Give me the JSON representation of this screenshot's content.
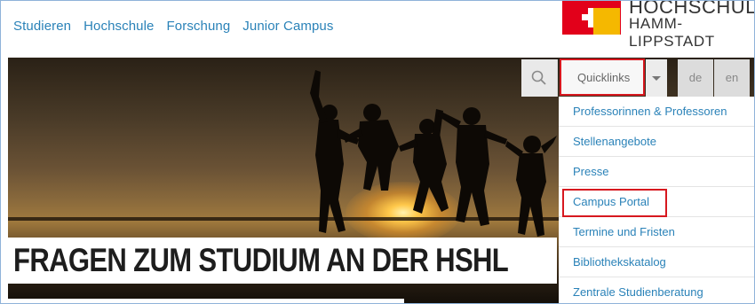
{
  "nav": {
    "items": [
      "Studieren",
      "Hochschule",
      "Forschung",
      "Junior Campus"
    ]
  },
  "logo": {
    "line1": "HOCHSCHULE",
    "line2": "HAMM-LIPPSTADT"
  },
  "toolbar": {
    "search_icon": "search-icon",
    "quicklinks_label": "Quicklinks",
    "lang_de": "de",
    "lang_en": "en"
  },
  "quicklinks": {
    "items": [
      "Professorinnen & Professoren",
      "Stellenangebote",
      "Presse",
      "Campus Portal",
      "Termine und Fristen",
      "Bibliothekskatalog",
      "Zentrale Studienberatung"
    ],
    "highlighted": "Campus Portal"
  },
  "hero": {
    "headline": "FRAGEN ZUM STUDIUM AN DER HSHL"
  },
  "colors": {
    "link": "#2a82b8",
    "highlight": "#d7181f",
    "logo_red": "#e2001a",
    "logo_yellow": "#f5b800"
  }
}
